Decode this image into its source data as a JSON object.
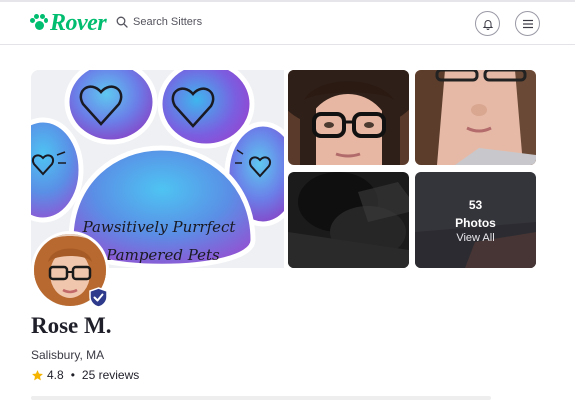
{
  "header": {
    "logo_text": "Rover",
    "search_label": "Search Sitters",
    "brand_color": "#00bd70",
    "notifications_icon": "bell-icon",
    "menu_icon": "hamburger-menu-icon"
  },
  "gallery": {
    "cover_text_line1": "Pawsitively Purrfect",
    "cover_text_line2": "Pampered Pets",
    "photo_count": "53",
    "photo_count_label": "Photos",
    "view_all_label": "View All"
  },
  "profile": {
    "name": "Rose M.",
    "location": "Salisbury, MA",
    "rating": "4.8",
    "separator": "•",
    "reviews": "25 reviews",
    "star_color": "#f4b400",
    "badge_icon": "verified-shield-icon"
  }
}
